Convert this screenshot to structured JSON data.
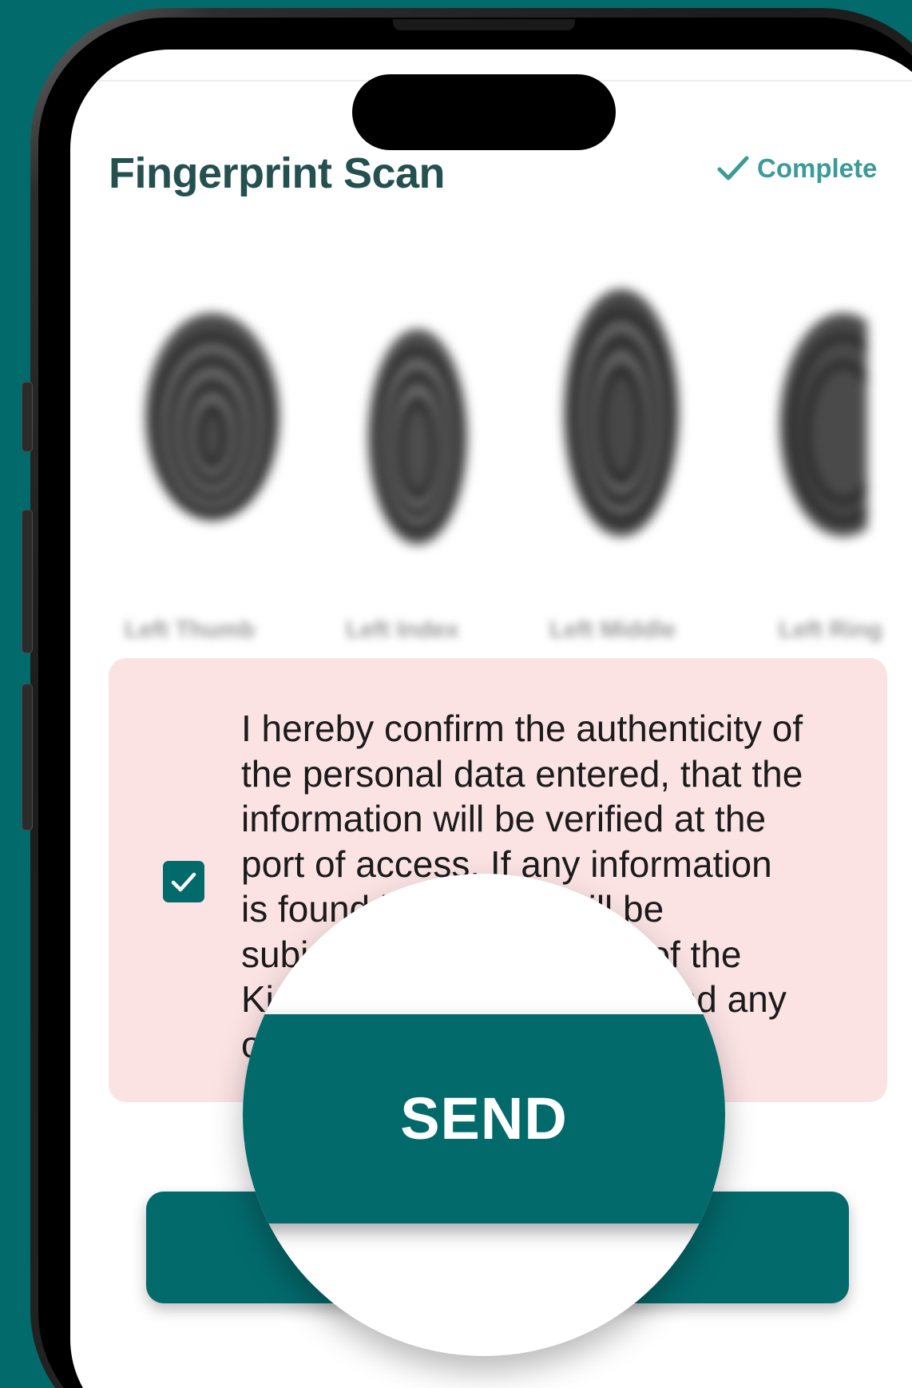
{
  "screen": {
    "title": "Fingerprint Scan",
    "status": {
      "label": "Complete",
      "icon": "check-icon",
      "color": "#3b9b99"
    }
  },
  "fingerprints": {
    "labels": [
      "Left Thumb",
      "Left Index",
      "Left Middle",
      "Left Ring"
    ]
  },
  "consent": {
    "checked": true,
    "visible_text": "I hereby confirm the authenticity of\nthe personal data entered, that the\ninformation will be verified at the\nport of access. If any information\nis found incorrect, I will be\nsubject to denial of entry of the\nKingdom of Saudi Arabia and any\nother penalties.",
    "background": "#fbe3e4"
  },
  "send_button": {
    "label": "SEND",
    "color": "#036a6c"
  },
  "colors": {
    "background": "#036a6c",
    "accent": "#036a6c",
    "title": "#24504f"
  }
}
